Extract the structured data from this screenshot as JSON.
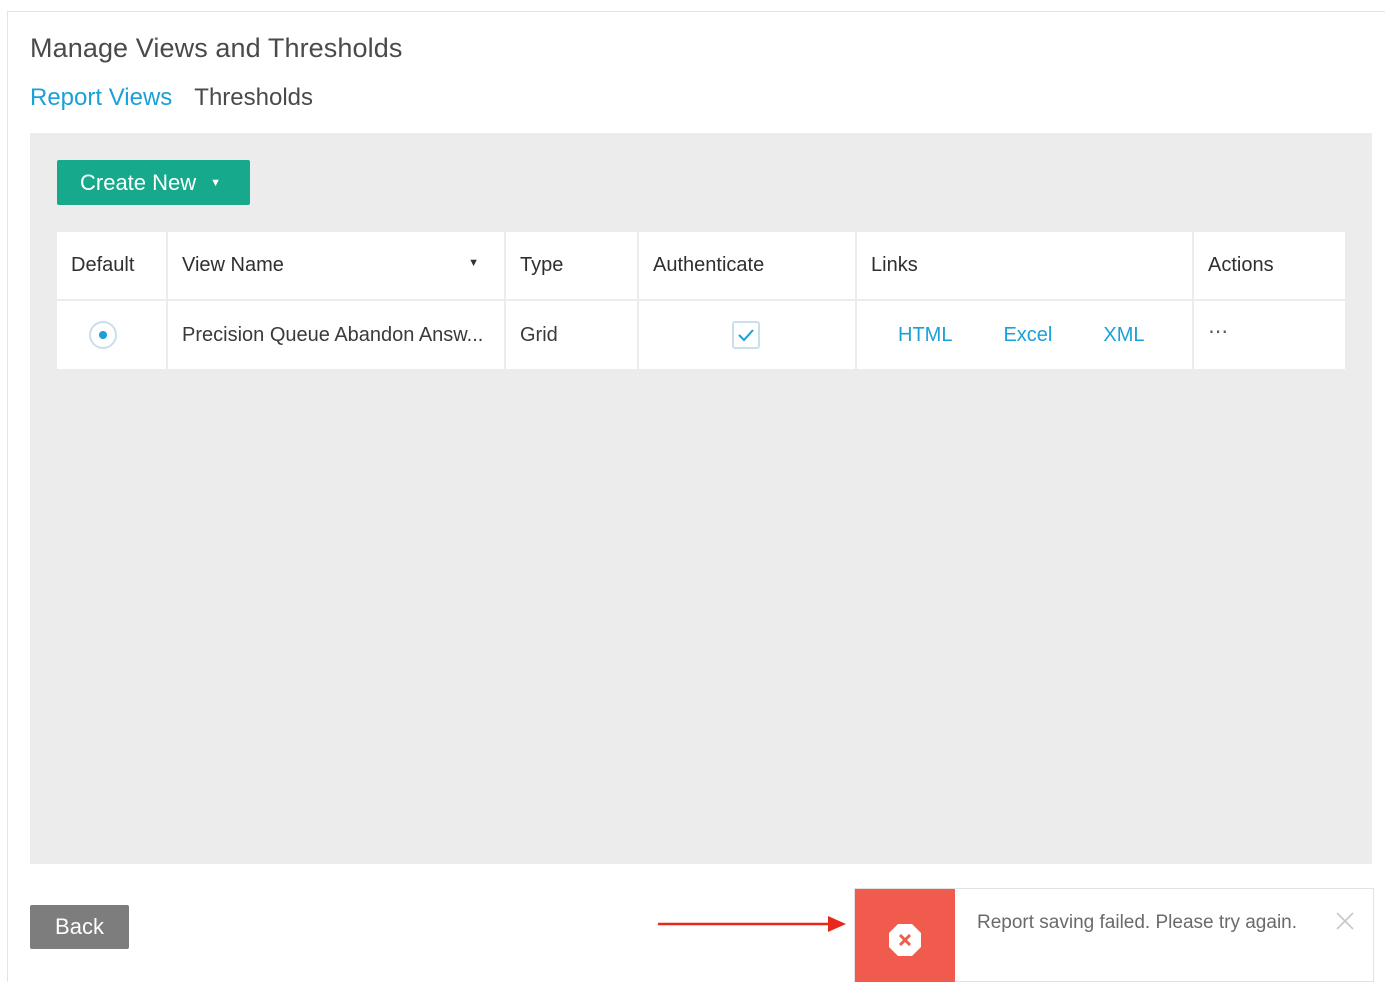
{
  "page": {
    "title": "Manage Views and Thresholds"
  },
  "tabs": [
    {
      "label": "Report Views",
      "active": true
    },
    {
      "label": "Thresholds",
      "active": false
    }
  ],
  "toolbar": {
    "create_label": "Create New"
  },
  "table": {
    "headers": {
      "default": "Default",
      "view_name": "View Name",
      "type": "Type",
      "authenticate": "Authenticate",
      "links": "Links",
      "actions": "Actions"
    },
    "rows": [
      {
        "default_selected": true,
        "view_name": "Precision Queue Abandon Answ...",
        "type": "Grid",
        "authenticate": true,
        "links": [
          "HTML",
          "Excel",
          "XML"
        ],
        "actions": "⋯"
      }
    ]
  },
  "footer": {
    "back_label": "Back"
  },
  "toast": {
    "message": "Report saving failed. Please try again.",
    "status": "error"
  },
  "colors": {
    "accent": "#1ba0d8",
    "primary_button": "#16a98b",
    "error": "#f15b4e",
    "annotation_arrow": "#e8281c",
    "panel_bg": "#ececec"
  },
  "icons": {
    "sort": "caret-down-icon",
    "create_dropdown": "caret-down-icon",
    "check": "check-icon",
    "error": "error-octagon-icon",
    "close": "close-icon"
  }
}
